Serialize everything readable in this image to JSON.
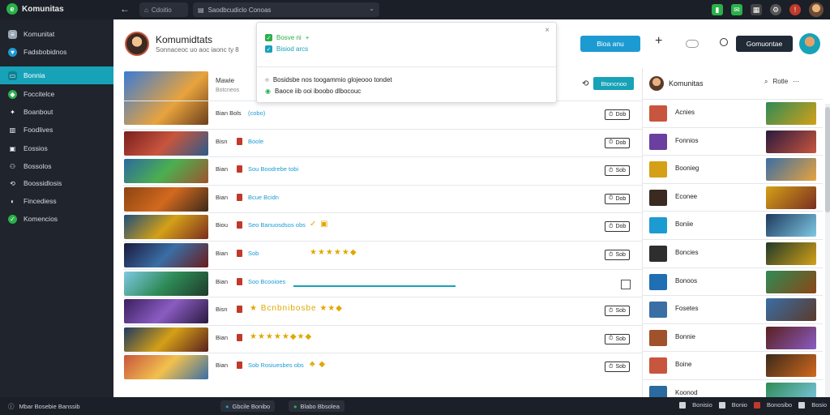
{
  "topbar": {
    "app_name": "Komunitas",
    "back": "←",
    "url_pill": "Cdoitio",
    "address": "Saodbcudiclo Conoas",
    "icons": [
      "chart-icon",
      "notification-icon",
      "grid-icon",
      "settings-icon",
      "alert-icon"
    ]
  },
  "sidebar": {
    "items": [
      {
        "label": "Komunitat",
        "icon": "list-icon",
        "color": "#9aa7b5"
      },
      {
        "label": "Fadsbobidnos",
        "icon": "heart-icon",
        "color": "#1c9bd2"
      },
      {
        "label": "Bonnia",
        "icon": "chat-icon",
        "color": "#17a2b8"
      },
      {
        "label": "Foccitelce",
        "icon": "shield-icon",
        "color": "#2bb04a"
      },
      {
        "label": "Boanbout",
        "icon": "pin-icon",
        "color": "#9aa7b5"
      },
      {
        "label": "Foodlives",
        "icon": "calendar-icon",
        "color": "#9aa7b5"
      },
      {
        "label": "Eossios",
        "icon": "folder-icon",
        "color": "#9aa7b5"
      },
      {
        "label": "Bossolos",
        "icon": "users-icon",
        "color": "#9aa7b5"
      },
      {
        "label": "Boossidlosis",
        "icon": "share-icon",
        "color": "#9aa7b5"
      },
      {
        "label": "Fincediess",
        "icon": "globe-icon",
        "color": "#9aa7b5"
      },
      {
        "label": "Komencios",
        "icon": "check-icon",
        "color": "#2bb04a"
      }
    ]
  },
  "header": {
    "title": "Komumidtats",
    "subtitle": "Sonnaceoc uo aoc iaonc ty 8",
    "primary_button": "Bioa anu",
    "dark_button": "Gomuontae",
    "plus": "+"
  },
  "popup": {
    "line1": "Bosve ni",
    "line2": "Bisiod arcs",
    "line3": "Bosidsbe nos toogammio glojeooo tondet",
    "line4": "Baoce iib ooi iboobo dlbocouc",
    "close": "×"
  },
  "table": {
    "header_label": "Mawie",
    "header_sub": "Botcneos",
    "header_button": "Btoncnoo",
    "rows": [
      {
        "title": "Bian Bols",
        "tag": "(cobo)",
        "extra": "",
        "count": "Dob",
        "kind": "count"
      },
      {
        "title": "Bisn",
        "tag": "Boole",
        "extra": "",
        "count": "Dob",
        "kind": "count"
      },
      {
        "title": "Bian",
        "tag": "Sou Boodrebe tobi",
        "extra": "",
        "count": "Sob",
        "kind": "count"
      },
      {
        "title": "Bian",
        "tag": "Bcue Bcidn",
        "extra": "",
        "count": "Dob",
        "kind": "count"
      },
      {
        "title": "Biou",
        "tag": "Seo Banuosdsos obs",
        "extra": "✓ ▣",
        "count": "Dob",
        "kind": "count"
      },
      {
        "title": "Bian",
        "tag": "Sob",
        "extra": "★★★★★◆",
        "count": "Sob",
        "kind": "count"
      },
      {
        "title": "Bian",
        "tag": "Soo Bcooioes",
        "extra": "",
        "count": "",
        "kind": "check"
      },
      {
        "title": "Bisn",
        "tag": "",
        "extra": "★ Bcnbnibosbe ★★◆",
        "count": "Sob",
        "kind": "count"
      },
      {
        "title": "Bian",
        "tag": "",
        "extra": "★★★★★◆★◆",
        "count": "Sob",
        "kind": "count"
      },
      {
        "title": "Bian",
        "tag": "Sob Rosiuesbes obs",
        "extra": "♣ ◆",
        "count": "Sob",
        "kind": "count"
      }
    ]
  },
  "right_panel": {
    "title": "Komunitas",
    "search": "Rotle",
    "items": [
      {
        "label": "Acnies"
      },
      {
        "label": "Fonnios"
      },
      {
        "label": "Boonieg"
      },
      {
        "label": "Econee"
      },
      {
        "label": "Boniie"
      },
      {
        "label": "Boncies"
      },
      {
        "label": "Bonoos"
      },
      {
        "label": "Fosetes"
      },
      {
        "label": "Bonnie"
      },
      {
        "label": "Boine"
      },
      {
        "label": "Koonod"
      }
    ]
  },
  "bottombar": {
    "status": "Mbar Bosebie Banssib",
    "task1": "Gbcile Bonibo",
    "task2": "Blabo Bbsolea",
    "right": [
      "Bonisio",
      "Bonio",
      "Bonosibo",
      "Bosio"
    ]
  },
  "colors": {
    "accent": "#17a2b8",
    "primary": "#1c9bd2",
    "dark": "#1f2a36",
    "sidebar": "#1f242d",
    "green": "#2bb04a"
  }
}
